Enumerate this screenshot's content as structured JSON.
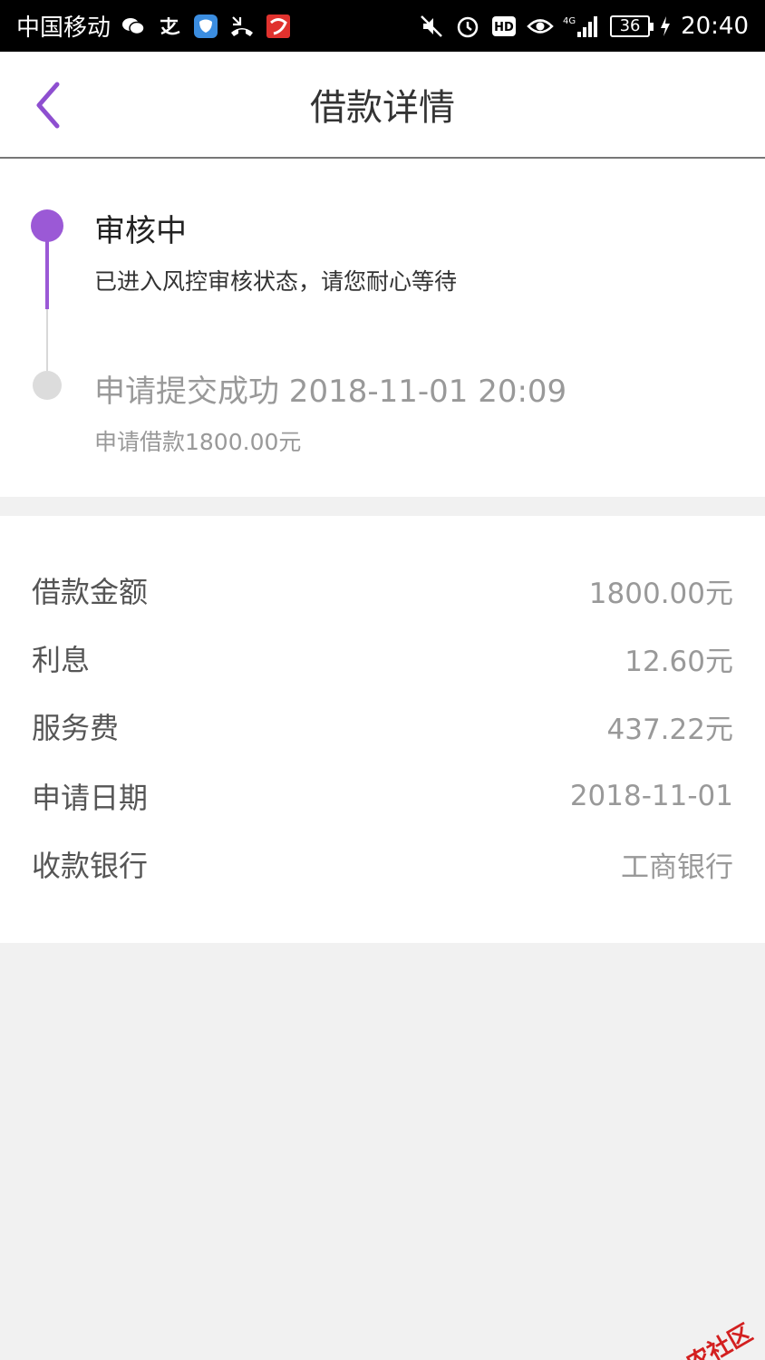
{
  "status_bar": {
    "carrier": "中国移动",
    "network": "4G",
    "battery": "36",
    "time": "20:40",
    "icons": [
      "wechat-icon",
      "alipay-icon",
      "chat-app-icon",
      "missed-call-icon",
      "app-notification-icon",
      "mute-icon",
      "alarm-icon",
      "hd-icon",
      "eye-icon",
      "signal-icon",
      "charging-icon"
    ]
  },
  "header": {
    "title": "借款详情",
    "back_icon": "chevron-left-icon"
  },
  "timeline": {
    "steps": [
      {
        "title": "审核中",
        "description": "已进入风控审核状态，请您耐心等待",
        "state": "active"
      },
      {
        "title": "申请提交成功 2018-11-01 20:09",
        "description": "申请借款1800.00元",
        "state": "done"
      }
    ]
  },
  "details": {
    "rows": [
      {
        "label": "借款金额",
        "value": "1800.00元"
      },
      {
        "label": "利息",
        "value": "12.60元"
      },
      {
        "label": "服务费",
        "value": "437.22元"
      },
      {
        "label": "申请日期",
        "value": "2018-11-01"
      },
      {
        "label": "收款银行",
        "value": "工商银行"
      }
    ]
  },
  "watermark": {
    "text": "卡农社区"
  },
  "colors": {
    "accent": "#9b59d6",
    "inactive": "#dcdcdc",
    "page_bg": "#f1f1f1"
  }
}
